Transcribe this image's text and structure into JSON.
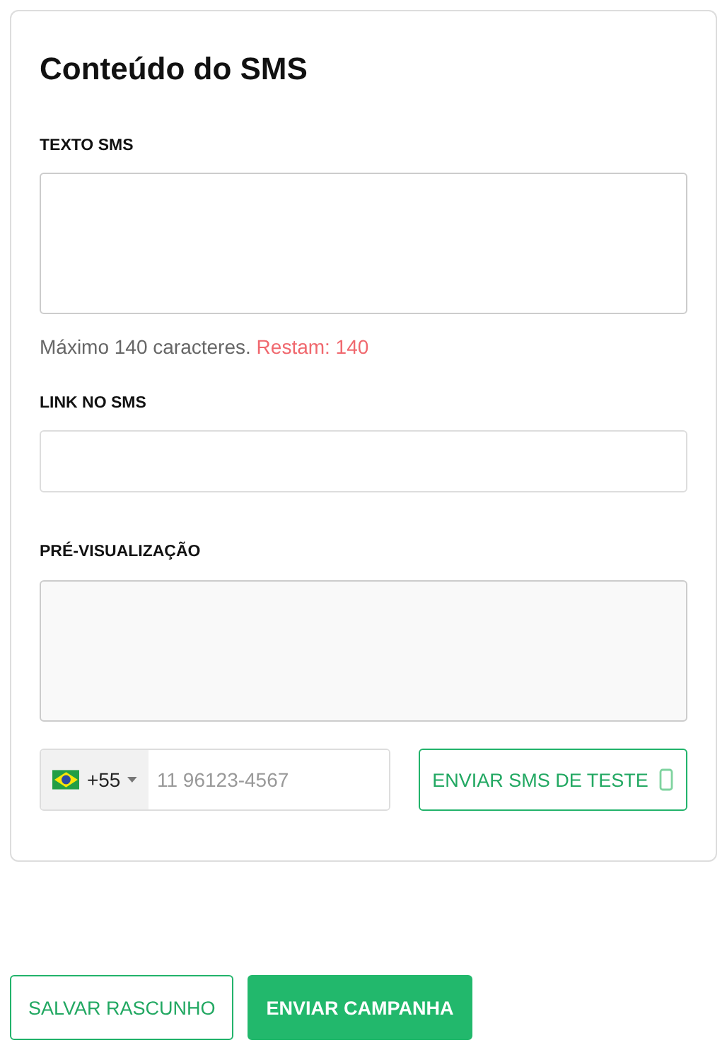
{
  "card": {
    "title": "Conteúdo do SMS",
    "sms_text": {
      "label": "TEXTO SMS",
      "hint": "Máximo 140 caracteres.",
      "remaining": "Restam: 140"
    },
    "link": {
      "label": "LINK NO SMS"
    },
    "preview": {
      "label": "PRÉ-VISUALIZAÇÃO"
    },
    "test": {
      "country_code": "+55",
      "placeholder": "11 96123-4567",
      "button": "ENVIAR SMS DE TESTE"
    }
  },
  "actions": [
    {
      "label": "SALVAR RASCUNHO",
      "kind": "outline"
    },
    {
      "label": "ENVIAR CAMPANHA",
      "kind": "primary"
    }
  ]
}
